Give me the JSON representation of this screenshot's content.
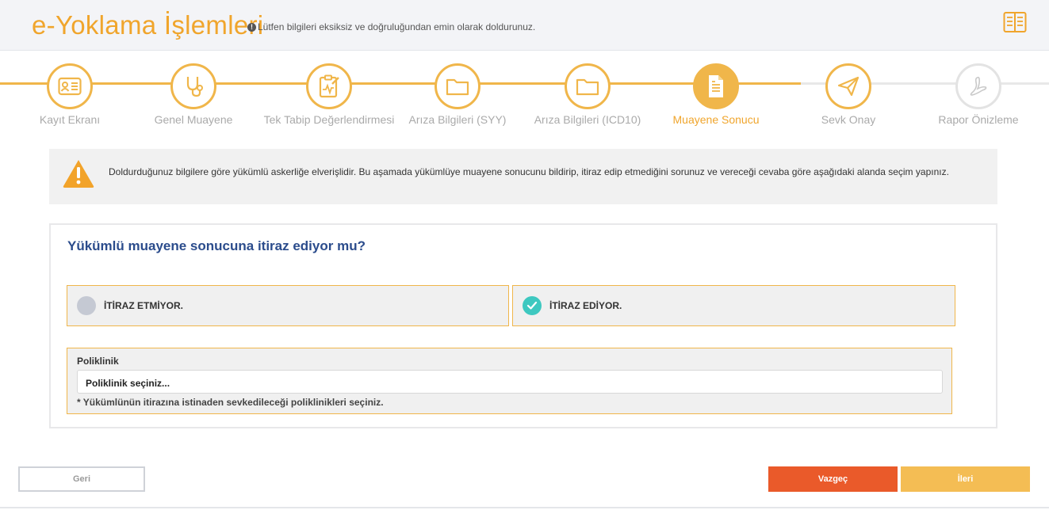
{
  "header": {
    "title": "e-Yoklama İşlemleri",
    "info_icon": "info-circle-icon",
    "info_text": "Lütfen bilgileri eksiksiz ve doğruluğundan emin olarak doldurunuz.",
    "book_icon": "book-icon"
  },
  "colors": {
    "accent": "#f0a52c",
    "cancel": "#ea5a2a",
    "next": "#f4bd54",
    "title_blue": "#2b4c8c",
    "check": "#3ec8c0"
  },
  "steps": [
    {
      "label": "Kayıt Ekranı",
      "icon": "id-card-icon",
      "state": "done"
    },
    {
      "label": "Genel Muayene",
      "icon": "stethoscope-icon",
      "state": "done"
    },
    {
      "label": "Tek Tabip Değerlendirmesi",
      "icon": "clipboard-icon",
      "state": "done"
    },
    {
      "label": "Arıza Bilgileri (SYY)",
      "icon": "folder-icon",
      "state": "done"
    },
    {
      "label": "Arıza Bilgileri (ICD10)",
      "icon": "folder-icon",
      "state": "done"
    },
    {
      "label": "Muayene Sonucu",
      "icon": "document-icon",
      "state": "active"
    },
    {
      "label": "Sevk Onay",
      "icon": "paper-plane-icon",
      "state": "done"
    },
    {
      "label": "Rapor Önizleme",
      "icon": "pdf-icon",
      "state": "pending"
    }
  ],
  "warning": {
    "icon": "warning-icon",
    "text": "Doldurduğunuz bilgilere göre yükümlü askerliğe elverişlidir. Bu aşamada yükümlüye muayene sonucunu bildirip, itiraz edip etmediğini sorunuz ve vereceği cevaba göre aşağıdaki alanda seçim yapınız."
  },
  "question": {
    "title": "Yükümlü muayene sonucuna itiraz ediyor mu?",
    "options": [
      {
        "label": "İTİRAZ ETMİYOR.",
        "selected": false
      },
      {
        "label": "İTİRAZ EDİYOR.",
        "selected": true
      }
    ]
  },
  "poliklinik": {
    "label": "Poliklinik",
    "placeholder": "Poliklinik seçiniz...",
    "hint": "* Yükümlünün itirazına istinaden sevkedileceği poliklinikleri seçiniz."
  },
  "buttons": {
    "back": "Geri",
    "cancel": "Vazgeç",
    "next": "İleri"
  }
}
